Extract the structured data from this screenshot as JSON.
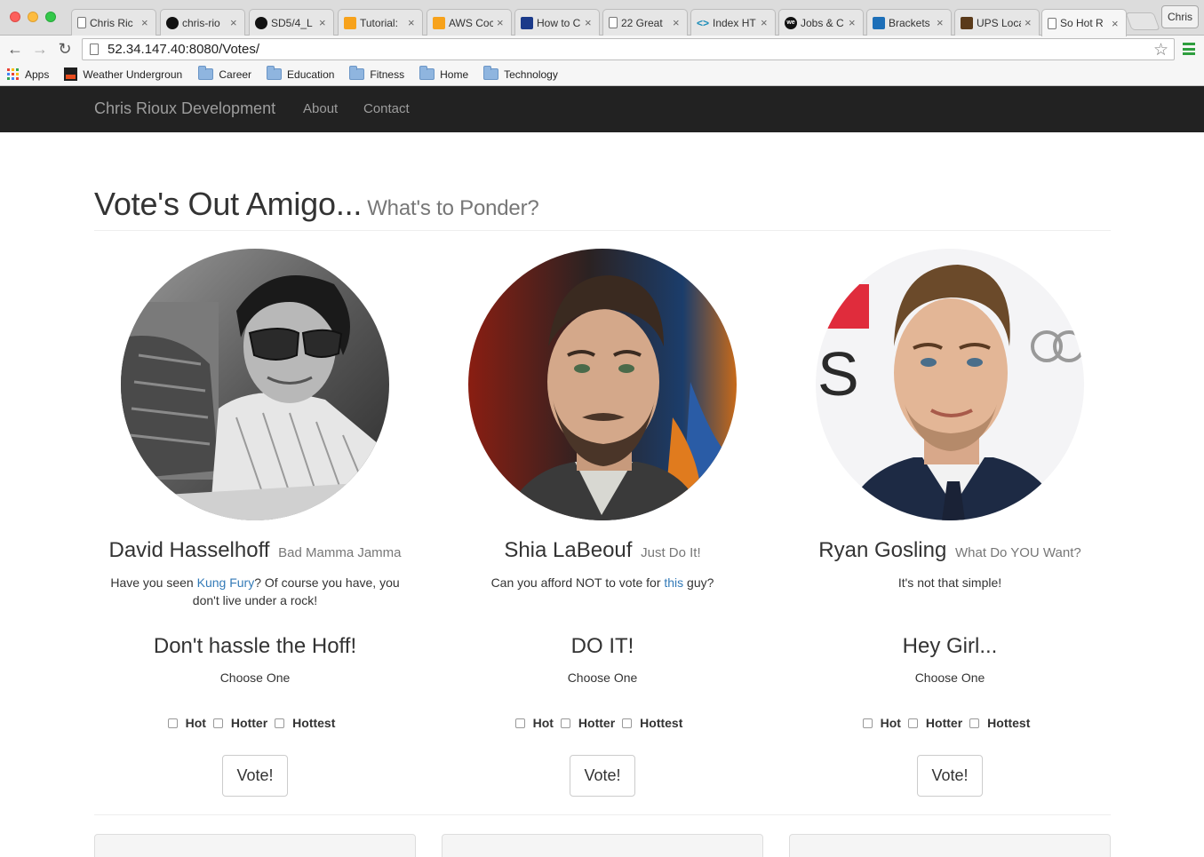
{
  "browser": {
    "tabs": [
      {
        "title": "Chris Ric",
        "icon": "page-icon"
      },
      {
        "title": "chris-rio",
        "icon": "github-icon"
      },
      {
        "title": "SD5/4_L",
        "icon": "github-icon"
      },
      {
        "title": "Tutorial:",
        "icon": "aws-icon"
      },
      {
        "title": "AWS Coc",
        "icon": "aws-icon"
      },
      {
        "title": "How to C",
        "icon": "site-icon"
      },
      {
        "title": "22 Great",
        "icon": "page-icon"
      },
      {
        "title": "Index HT",
        "icon": "code-icon"
      },
      {
        "title": "Jobs & C",
        "icon": "we-icon"
      },
      {
        "title": "Brackets",
        "icon": "brackets-icon"
      },
      {
        "title": "UPS Loca",
        "icon": "ups-icon"
      },
      {
        "title": "So Hot R",
        "icon": "page-icon",
        "active": true
      }
    ],
    "tab_close": "×",
    "profile_name": "Chris",
    "url": "52.34.147.40:8080/Votes/",
    "bookmarks": {
      "apps": "Apps",
      "weather": "Weather Undergroun",
      "career": "Career",
      "education": "Education",
      "fitness": "Fitness",
      "home": "Home",
      "technology": "Technology"
    }
  },
  "navbar": {
    "brand": "Chris Rioux Development",
    "about": "About",
    "contact": "Contact"
  },
  "header": {
    "title": "Vote's Out Amigo...",
    "subtitle": "What's to Ponder?"
  },
  "candidates": [
    {
      "name": "David Hasselhoff",
      "tagline": "Bad Mamma Jamma",
      "blurb_pre": "Have you seen ",
      "blurb_link": "Kung Fury",
      "blurb_post": "? Of course you have, you don't live under a rock!",
      "slogan": "Don't hassle the Hoff!",
      "choose": "Choose One",
      "options": [
        "Hot",
        "Hotter",
        "Hottest"
      ],
      "vote": "Vote!"
    },
    {
      "name": "Shia LaBeouf",
      "tagline": "Just Do It!",
      "blurb_pre": "Can you afford NOT to vote for ",
      "blurb_link": "this",
      "blurb_post": " guy?",
      "slogan": "DO IT!",
      "choose": "Choose One",
      "options": [
        "Hot",
        "Hotter",
        "Hottest"
      ],
      "vote": "Vote!"
    },
    {
      "name": "Ryan Gosling",
      "tagline": "What Do YOU Want?",
      "blurb_pre": "It's not that simple!",
      "blurb_link": "",
      "blurb_post": "",
      "slogan": "Hey Girl...",
      "choose": "Choose One",
      "options": [
        "Hot",
        "Hotter",
        "Hottest"
      ],
      "vote": "Vote!"
    }
  ],
  "colors": {
    "navbar_bg": "#222222",
    "link": "#337ab7"
  }
}
